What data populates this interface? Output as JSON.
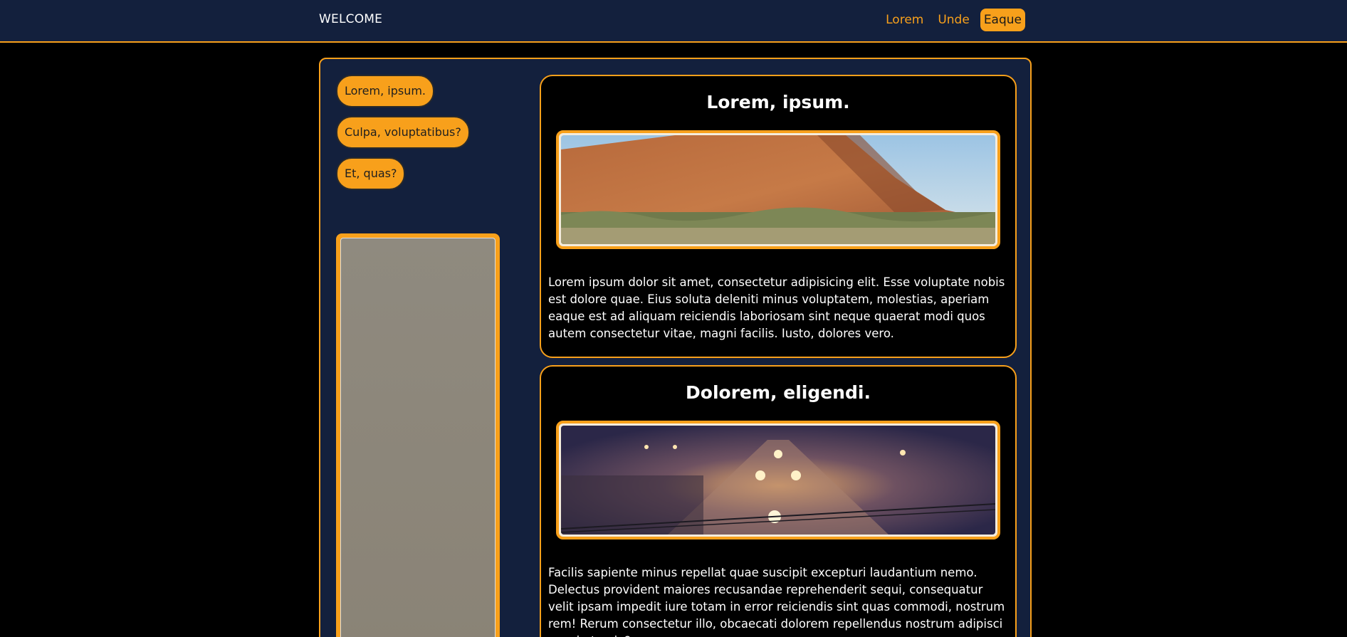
{
  "nav": {
    "brand": "WELCOME",
    "links": [
      "Lorem",
      "Unde",
      "Eaque"
    ],
    "active_index": 2
  },
  "sidebar": {
    "buttons": [
      "Lorem, ipsum.",
      "Culpa, voluptatibus?",
      "Et, quas?"
    ]
  },
  "cards": [
    {
      "title": "Lorem, ipsum.",
      "text": "Lorem ipsum dolor sit amet, consectetur adipisicing elit. Esse voluptate nobis est dolore quae. Eius soluta deleniti minus voluptatem, molestias, aperiam eaque est ad aliquam reiciendis laboriosam sint neque quaerat modi quos autem consectetur vitae, magni facilis. Iusto, dolores vero."
    },
    {
      "title": "Dolorem, eligendi.",
      "text": "Facilis sapiente minus repellat quae suscipit excepturi laudantium nemo. Delectus provident maiores recusandae reprehenderit sequi, consequatur velit ipsam impedit iure totam in error reiciendis sint quas commodi, nostrum rem! Rerum consectetur illo, obcaecati dolorem repellendus nostrum adipisci sequi ut quia?"
    }
  ],
  "colors": {
    "accent": "#f8a01b",
    "navy": "#13203d",
    "background": "#000000"
  }
}
